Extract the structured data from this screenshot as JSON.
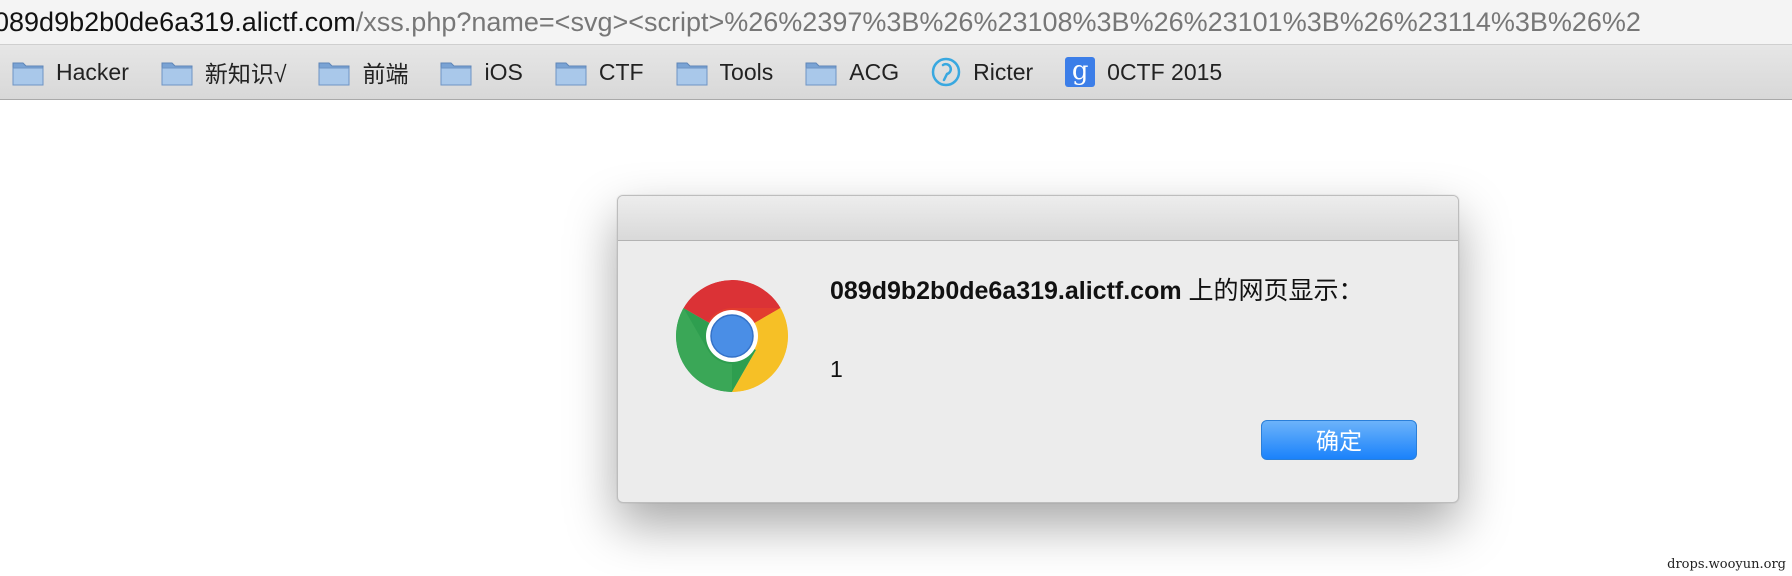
{
  "address_bar": {
    "host": "089d9b2b0de6a319.alictf.com",
    "path": "/xss.php?name=<svg><script>%26%2397%3B%26%23108%3B%26%23101%3B%26%23114%3B%26%2"
  },
  "bookmarks": [
    {
      "label": "Hacker",
      "icon": "folder-icon"
    },
    {
      "label": "新知识√",
      "icon": "folder-icon"
    },
    {
      "label": "前端",
      "icon": "folder-icon"
    },
    {
      "label": "iOS",
      "icon": "folder-icon"
    },
    {
      "label": "CTF",
      "icon": "folder-icon"
    },
    {
      "label": "Tools",
      "icon": "folder-icon"
    },
    {
      "label": "ACG",
      "icon": "folder-icon"
    },
    {
      "label": "Ricter",
      "icon": "ricter-icon"
    },
    {
      "label": "0CTF 2015",
      "icon": "google-g-icon",
      "icon_glyph": "g"
    }
  ],
  "dialog": {
    "title_host": "089d9b2b0de6a319.alictf.com",
    "title_suffix": " 上的网页显示：",
    "message": "1",
    "ok_label": "确定",
    "icon": "chrome-logo-icon"
  },
  "watermark": "drops.wooyun.org",
  "colors": {
    "ok_button": "#1a82fb",
    "google_icon_bg": "#3c7ee8",
    "ricter_icon": "#39a8e0",
    "folder": "#8fb3d9"
  }
}
